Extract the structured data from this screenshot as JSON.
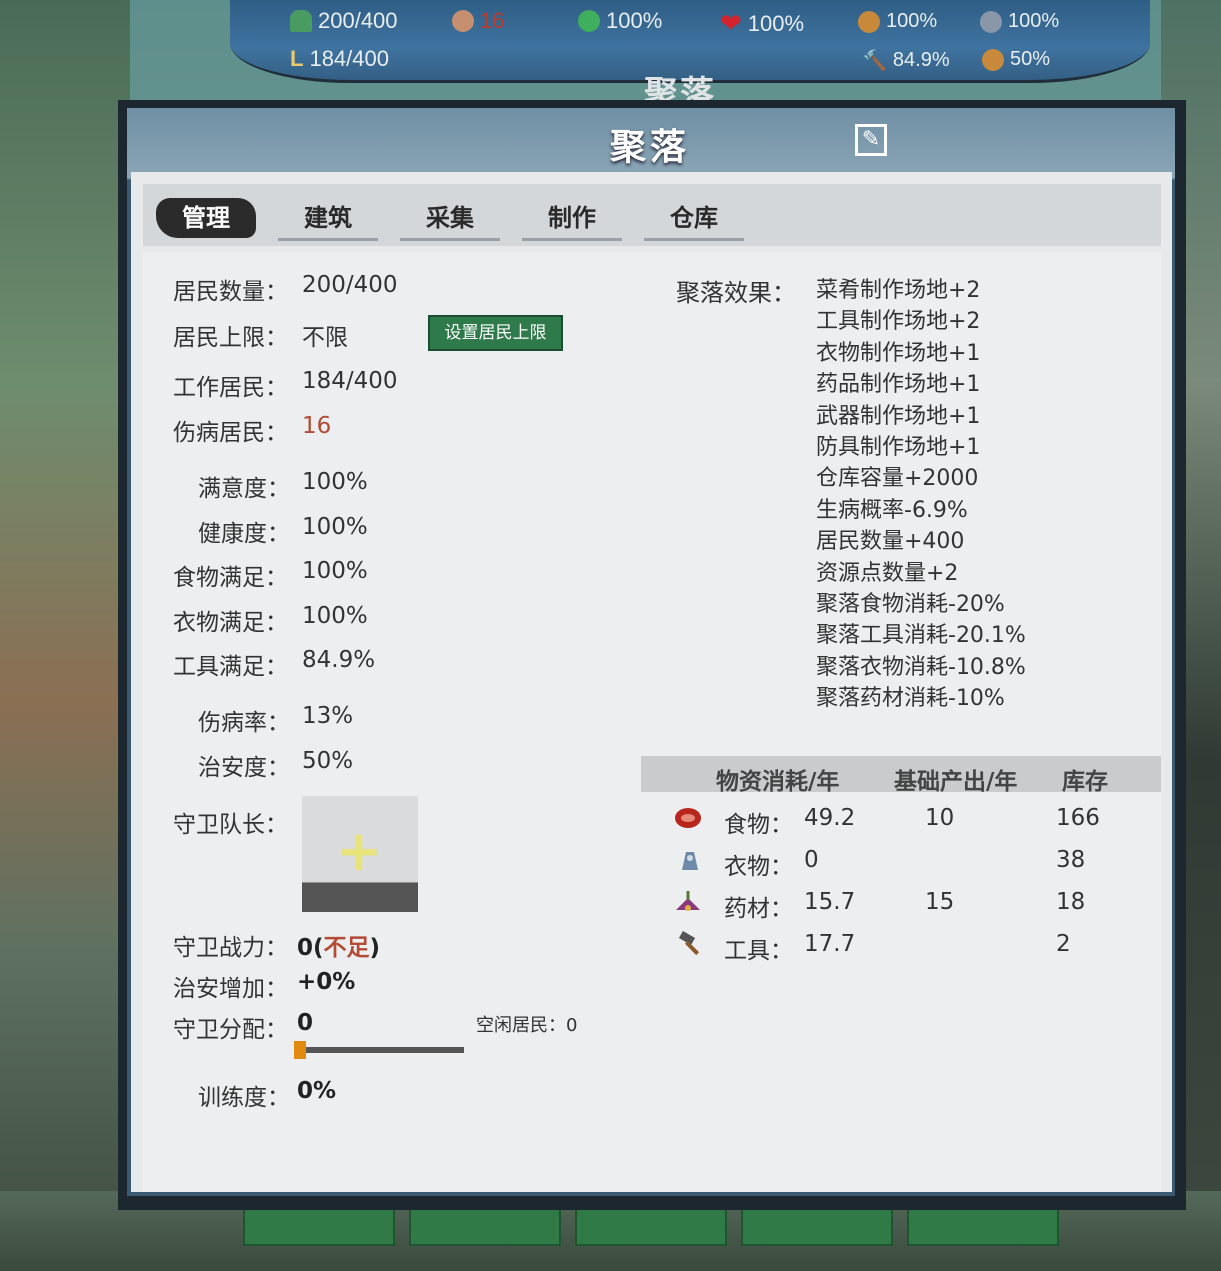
{
  "topbar": {
    "residents": "200/400",
    "injured": "16",
    "satisfaction": "100%",
    "health": "100%",
    "food": "100%",
    "clothing": "100%",
    "workers": "184/400",
    "tools": "84.9%",
    "security": "50%",
    "title": "聚落"
  },
  "panel": {
    "title": "聚落"
  },
  "tabs": [
    "管理",
    "建筑",
    "采集",
    "制作",
    "仓库"
  ],
  "stats": {
    "residents_label": "居民数量：",
    "residents_value": "200/400",
    "limit_label": "居民上限：",
    "limit_value": "不限",
    "limit_button": "设置居民上限",
    "workers_label": "工作居民：",
    "workers_value": "184/400",
    "injured_label": "伤病居民：",
    "injured_value": "16",
    "satisfaction_label": "满意度：",
    "satisfaction_value": "100%",
    "health_label": "健康度：",
    "health_value": "100%",
    "food_label": "食物满足：",
    "food_value": "100%",
    "clothing_label": "衣物满足：",
    "clothing_value": "100%",
    "tools_label": "工具满足：",
    "tools_value": "84.9%",
    "injury_rate_label": "伤病率：",
    "injury_rate_value": "13%",
    "security_label": "治安度：",
    "security_value": "50%"
  },
  "guard": {
    "captain_label": "守卫队长：",
    "power_label": "守卫战力：",
    "power_value": "0(",
    "power_insufficient": "不足",
    "power_close": ")",
    "security_bonus_label": "治安增加：",
    "security_bonus_value": "+0%",
    "assign_label": "守卫分配：",
    "assign_value": "0",
    "assign_fraction": 0,
    "idle_label": "空闲居民：",
    "idle_value": "0",
    "training_label": "训练度：",
    "training_value": "0%"
  },
  "effects": {
    "label": "聚落效果：",
    "items": [
      "菜肴制作场地+2",
      "工具制作场地+2",
      "衣物制作场地+1",
      "药品制作场地+1",
      "武器制作场地+1",
      "防具制作场地+1",
      "仓库容量+2000",
      "生病概率-6.9%",
      "居民数量+400",
      "资源点数量+2",
      "聚落食物消耗-20%",
      "聚落工具消耗-20.1%",
      "聚落衣物消耗-10.8%",
      "聚落药材消耗-10%"
    ]
  },
  "resources": {
    "headers": [
      "物资消耗/年",
      "基础产出/年",
      "库存"
    ],
    "rows": [
      {
        "icon": "meat-icon",
        "name": "食物：",
        "consumption": "49.2",
        "production": "10",
        "stock": "166"
      },
      {
        "icon": "clothing-icon",
        "name": "衣物：",
        "consumption": "0",
        "production": "",
        "stock": "38"
      },
      {
        "icon": "herb-icon",
        "name": "药材：",
        "consumption": "15.7",
        "production": "15",
        "stock": "18"
      },
      {
        "icon": "hammer-icon",
        "name": "工具：",
        "consumption": "17.7",
        "production": "",
        "stock": "2"
      }
    ]
  }
}
